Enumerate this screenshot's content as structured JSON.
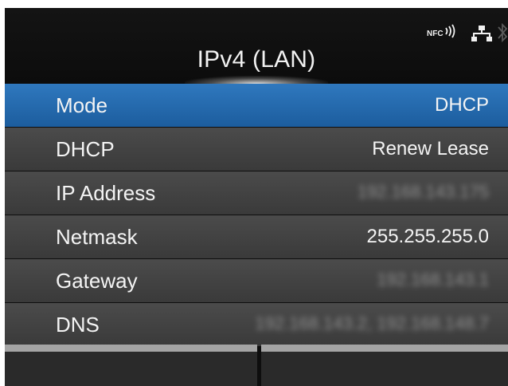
{
  "header": {
    "title": "IPv4 (LAN)",
    "nfc_label": "NFC",
    "icons": [
      "nfc-icon",
      "lan-icon",
      "bluetooth-icon"
    ]
  },
  "menu": {
    "items": [
      {
        "label": "Mode",
        "value": "DHCP",
        "selected": true,
        "obscured": false
      },
      {
        "label": "DHCP",
        "value": "Renew Lease",
        "selected": false,
        "obscured": false
      },
      {
        "label": "IP Address",
        "value": "192.168.143.175",
        "selected": false,
        "obscured": true
      },
      {
        "label": "Netmask",
        "value": "255.255.255.0",
        "selected": false,
        "obscured": false
      },
      {
        "label": "Gateway",
        "value": "192.168.143.1",
        "selected": false,
        "obscured": true
      },
      {
        "label": "DNS",
        "value": "192.168.143.2, 192.168.148.7",
        "selected": false,
        "obscured": true
      }
    ]
  },
  "softkeys": {
    "left_label": "",
    "right_label": ""
  },
  "colors": {
    "selected_row": "#2a6fb4",
    "row": "#444444",
    "background": "#0e0e0e",
    "softkey_bar": "#a4a4a4"
  }
}
